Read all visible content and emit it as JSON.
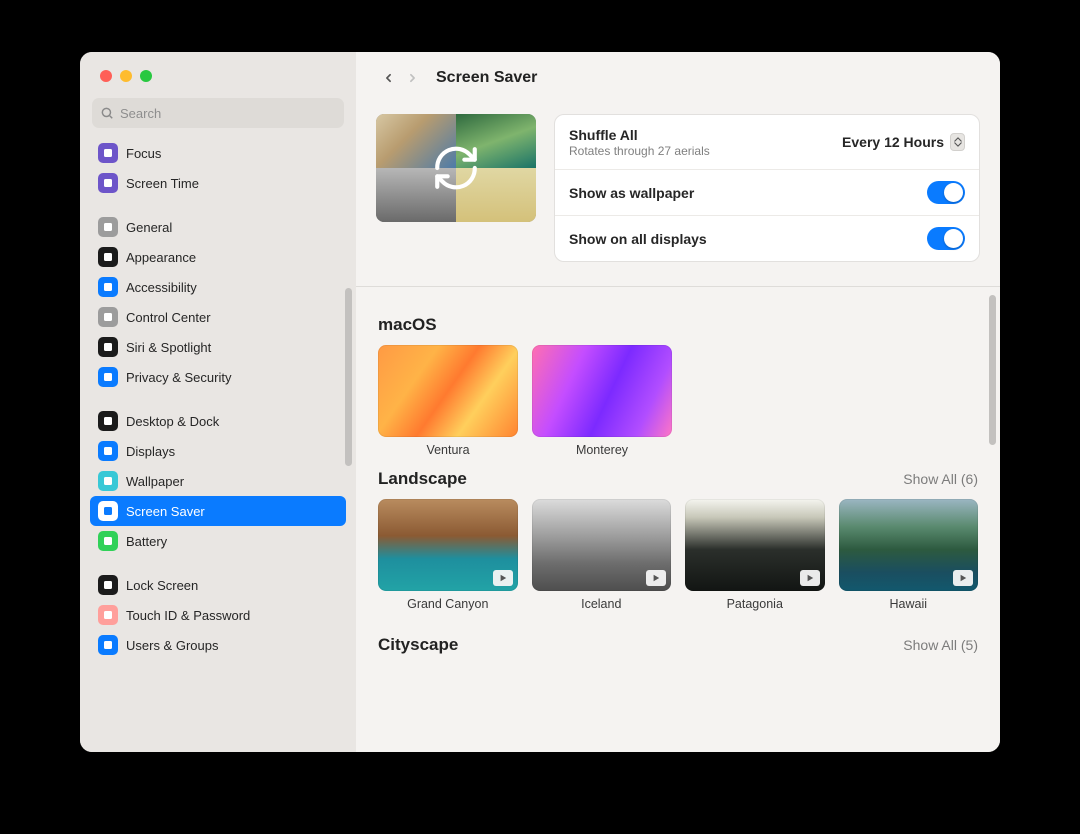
{
  "search": {
    "placeholder": "Search"
  },
  "sidebar": {
    "items": [
      {
        "label": "Focus",
        "icon_bg": "#6d55c9"
      },
      {
        "label": "Screen Time",
        "icon_bg": "#6d55c9"
      },
      {
        "label": "General",
        "icon_bg": "#9c9c9c"
      },
      {
        "label": "Appearance",
        "icon_bg": "#1b1b1b"
      },
      {
        "label": "Accessibility",
        "icon_bg": "#0a7bff"
      },
      {
        "label": "Control Center",
        "icon_bg": "#9c9c9c"
      },
      {
        "label": "Siri & Spotlight",
        "icon_bg": "#1b1b1b"
      },
      {
        "label": "Privacy & Security",
        "icon_bg": "#0a7bff"
      },
      {
        "label": "Desktop & Dock",
        "icon_bg": "#1b1b1b"
      },
      {
        "label": "Displays",
        "icon_bg": "#0a7bff"
      },
      {
        "label": "Wallpaper",
        "icon_bg": "#38c8d6"
      },
      {
        "label": "Screen Saver",
        "icon_bg": "#38c8d6",
        "selected": true
      },
      {
        "label": "Battery",
        "icon_bg": "#30d158"
      },
      {
        "label": "Lock Screen",
        "icon_bg": "#1b1b1b"
      },
      {
        "label": "Touch ID & Password",
        "icon_bg": "#ff9f9b"
      },
      {
        "label": "Users & Groups",
        "icon_bg": "#0a7bff"
      }
    ]
  },
  "page_title": "Screen Saver",
  "options": {
    "shuffle_title": "Shuffle All",
    "shuffle_sub": "Rotates through 27 aerials",
    "shuffle_value": "Every 12 Hours",
    "show_wallpaper": "Show as wallpaper",
    "show_wallpaper_on": true,
    "show_all_displays": "Show on all displays",
    "show_all_displays_on": true
  },
  "sections": {
    "macos": {
      "title": "macOS",
      "tiles": [
        {
          "label": "Ventura",
          "class": "th-ventura"
        },
        {
          "label": "Monterey",
          "class": "th-monterey"
        }
      ]
    },
    "landscape": {
      "title": "Landscape",
      "show_all": "Show All (6)",
      "tiles": [
        {
          "label": "Grand Canyon",
          "class": "th-grand"
        },
        {
          "label": "Iceland",
          "class": "th-iceland"
        },
        {
          "label": "Patagonia",
          "class": "th-patago"
        },
        {
          "label": "Hawaii",
          "class": "th-hawaii"
        }
      ]
    },
    "cityscape": {
      "title": "Cityscape",
      "show_all": "Show All (5)"
    }
  }
}
